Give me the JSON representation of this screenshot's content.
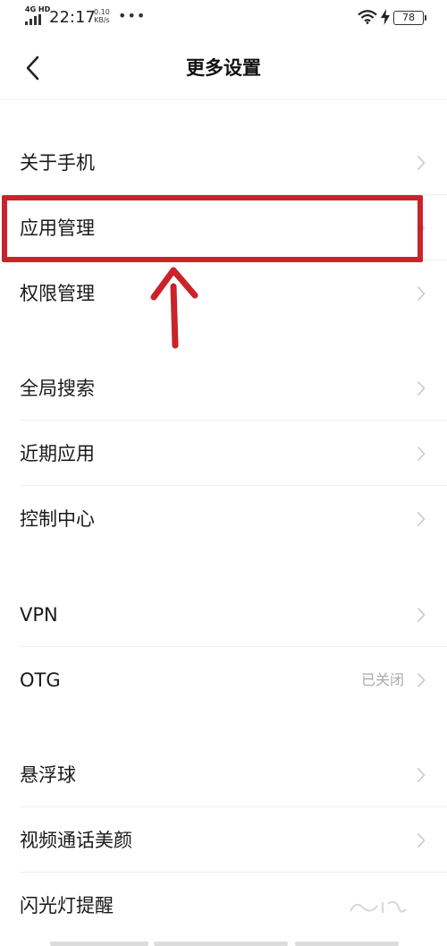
{
  "status_bar": {
    "network": "4G HD",
    "time": "22:17",
    "speed_value": "0.10",
    "speed_unit": "KB/s",
    "more": "•••",
    "battery": "78"
  },
  "header": {
    "title": "更多设置",
    "back_icon": "chevron-left-icon"
  },
  "groups": [
    {
      "items": [
        {
          "label": "关于手机"
        },
        {
          "label": "应用管理"
        },
        {
          "label": "权限管理"
        }
      ]
    },
    {
      "items": [
        {
          "label": "全局搜索"
        },
        {
          "label": "近期应用"
        },
        {
          "label": "控制中心"
        }
      ]
    },
    {
      "items": [
        {
          "label": "VPN"
        },
        {
          "label": "OTG",
          "value": "已关闭"
        }
      ]
    },
    {
      "items": [
        {
          "label": "悬浮球"
        },
        {
          "label": "视频通话美颜"
        },
        {
          "label": "闪光灯提醒"
        }
      ]
    }
  ],
  "annotation": {
    "highlighted_item": "应用管理",
    "color": "#c8242a"
  },
  "colors": {
    "background": "#ffffff",
    "text": "#1a1a1a",
    "secondary_text": "#aaaaaa",
    "chevron": "#c8c8c8",
    "divider": "#efefef"
  }
}
